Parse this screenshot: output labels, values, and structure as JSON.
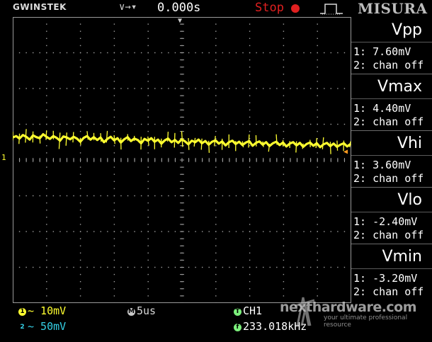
{
  "header": {
    "brand": "GWINSTEK",
    "trigger_slope": "∨→▾",
    "time_offset": "0.000s",
    "run_state": "Stop",
    "mode_title": "MISURA"
  },
  "colors": {
    "ch1": "#ffff30",
    "ch2": "#35d0e6",
    "stop": "#e02020",
    "grid_dots": "#a0a0a0",
    "trigger_level": "#ff9a20"
  },
  "markers": {
    "ch1": "1",
    "trigger_level": "◀",
    "trigger_position": "▼"
  },
  "measurements": [
    {
      "name": "Vpp",
      "ch1": "1: 7.60mV",
      "ch2": "2: chan off"
    },
    {
      "name": "Vmax",
      "ch1": "1: 4.40mV",
      "ch2": "2: chan off"
    },
    {
      "name": "Vhi",
      "ch1": "1: 3.60mV",
      "ch2": "2: chan off"
    },
    {
      "name": "Vlo",
      "ch1": "1: -2.40mV",
      "ch2": "2: chan off"
    },
    {
      "name": "Vmin",
      "ch1": "1: -3.20mV",
      "ch2": "2: chan off"
    }
  ],
  "status": {
    "ch1_badge": "1",
    "ch1_scale": "~ 10mV",
    "ch2_badge": "2",
    "ch2_scale": "~ 50mV",
    "timebase_badge": "M",
    "timebase": "5us",
    "trigger_badge": "T",
    "trigger_source": "CH1",
    "freq_badge": "f",
    "frequency": "233.018kHz"
  },
  "watermark": {
    "text": "nexthardware.com",
    "subtitle": "your ultimate professional resource"
  },
  "chart_data": {
    "type": "line",
    "x_divisions": 10,
    "y_divisions": 8,
    "series": [
      {
        "values": [
          0.18,
          0.22,
          0.15,
          0.25,
          0.2,
          0.12,
          0.24,
          0.19,
          0.16,
          0.27,
          0.2,
          0.14,
          0.22,
          0.17,
          0.09,
          0.21,
          0.18,
          0.13,
          0.2,
          0.15,
          0.06,
          0.17,
          0.22,
          0.12,
          0.19,
          0.11,
          0.18,
          0.05,
          0.14,
          0.2,
          0.1,
          0.16,
          0.04,
          0.13,
          0.19,
          0.08,
          0.15,
          0.11,
          0.02,
          0.14,
          0.09,
          0.16,
          0.06,
          0.12,
          0.01,
          0.1,
          0.15,
          0.05,
          0.11,
          0.03,
          0.13,
          0.07,
          -0.01,
          0.09,
          0.05,
          0.12,
          0.02,
          0.08,
          -0.02,
          0.06,
          0.1,
          0.01,
          0.07,
          -0.04,
          0.05,
          0.09,
          0.0,
          0.06,
          -0.03,
          0.04,
          0.08,
          -0.05,
          0.03,
          0.07,
          -0.02,
          0.05,
          -0.06,
          0.02,
          0.06,
          -0.03,
          0.04,
          -0.07,
          0.01,
          0.05,
          -0.04,
          0.03,
          -0.08,
          0.0,
          0.04,
          -0.05,
          0.02,
          -0.09,
          -0.01,
          0.03,
          -0.06,
          0.01,
          -0.08,
          -0.02,
          0.02,
          -0.07,
          0.0
        ]
      }
    ]
  }
}
